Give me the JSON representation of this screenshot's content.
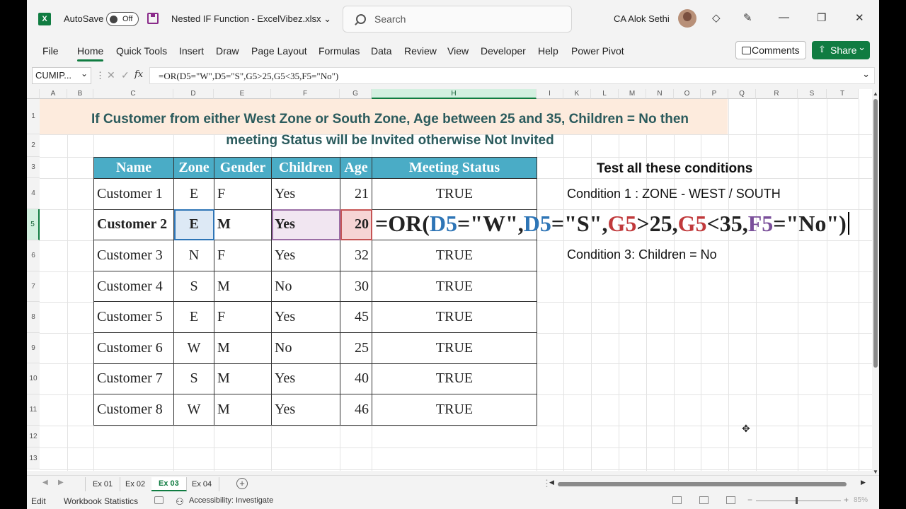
{
  "titlebar": {
    "autosave_label": "AutoSave",
    "autosave_state": "Off",
    "filename": "Nested IF Function - ExcelVibez.xlsx",
    "search_placeholder": "Search",
    "user_name": "CA Alok Sethi"
  },
  "ribbon": {
    "tabs": [
      "File",
      "Home",
      "Quick Tools",
      "Insert",
      "Draw",
      "Page Layout",
      "Formulas",
      "Data",
      "Review",
      "View",
      "Developer",
      "Help",
      "Power Pivot"
    ],
    "active_tab": "Home",
    "comments_label": "Comments",
    "share_label": "Share"
  },
  "formula_bar": {
    "name_box": "CUMIP...",
    "formula": "=OR(D5=\"W\",D5=\"S\",G5>25,G5<35,F5=\"No\")"
  },
  "grid": {
    "columns": [
      "A",
      "B",
      "C",
      "D",
      "E",
      "F",
      "G",
      "H",
      "I",
      "K",
      "L",
      "M",
      "N",
      "O",
      "P",
      "Q",
      "R",
      "S",
      "T"
    ],
    "rows": [
      "1",
      "2",
      "3",
      "4",
      "5",
      "6",
      "7",
      "8",
      "9",
      "10",
      "11",
      "12",
      "13"
    ]
  },
  "banner": {
    "line1": "If Customer from either West Zone or South Zone, Age between 25 and 35, Children = No then",
    "line2": "meeting Status will be Invited otherwise Not Invited"
  },
  "table": {
    "headers": [
      "Name",
      "Zone",
      "Gender",
      "Children",
      "Age",
      "Meeting Status"
    ],
    "rows": [
      [
        "Customer 1",
        "E",
        "F",
        "Yes",
        "21",
        "TRUE"
      ],
      [
        "Customer 2",
        "E",
        "M",
        "Yes",
        "20",
        ""
      ],
      [
        "Customer 3",
        "N",
        "F",
        "Yes",
        "32",
        "TRUE"
      ],
      [
        "Customer 4",
        "S",
        "M",
        "No",
        "30",
        "TRUE"
      ],
      [
        "Customer 5",
        "E",
        "F",
        "Yes",
        "45",
        "TRUE"
      ],
      [
        "Customer 6",
        "W",
        "M",
        "No",
        "25",
        "TRUE"
      ],
      [
        "Customer 7",
        "S",
        "M",
        "Yes",
        "40",
        "TRUE"
      ],
      [
        "Customer 8",
        "W",
        "M",
        "Yes",
        "46",
        "TRUE"
      ]
    ],
    "editing_formula": {
      "p1": "=OR(",
      "r1": "D5",
      "p2": "=\"W\",",
      "r2": "D5",
      "p3": "=\"S\",",
      "r3": "G5",
      "p4": ">25,",
      "r4": "G5",
      "p5": "<35,",
      "r5": "F5",
      "p6": "=\"No\")"
    }
  },
  "conditions": {
    "title": "Test all these conditions",
    "cond1": "Condition 1 : ZONE - WEST / SOUTH",
    "cond3": "Condition 3: Children = No"
  },
  "sheets": {
    "tabs": [
      "Ex 01",
      "Ex 02",
      "Ex 03",
      "Ex 04"
    ],
    "active": "Ex 03"
  },
  "statusbar": {
    "mode": "Edit",
    "workbook_stats": "Workbook Statistics",
    "accessibility": "Accessibility: Investigate",
    "zoom": "85%"
  },
  "colors": {
    "excel_green": "#107c41",
    "header_fill": "#4aacc6",
    "banner_fill": "#fdebdd",
    "banner_text": "#2b5b5d",
    "ref_d": "#2e75b6",
    "ref_g": "#c0393b",
    "ref_f": "#7a4f9a"
  }
}
